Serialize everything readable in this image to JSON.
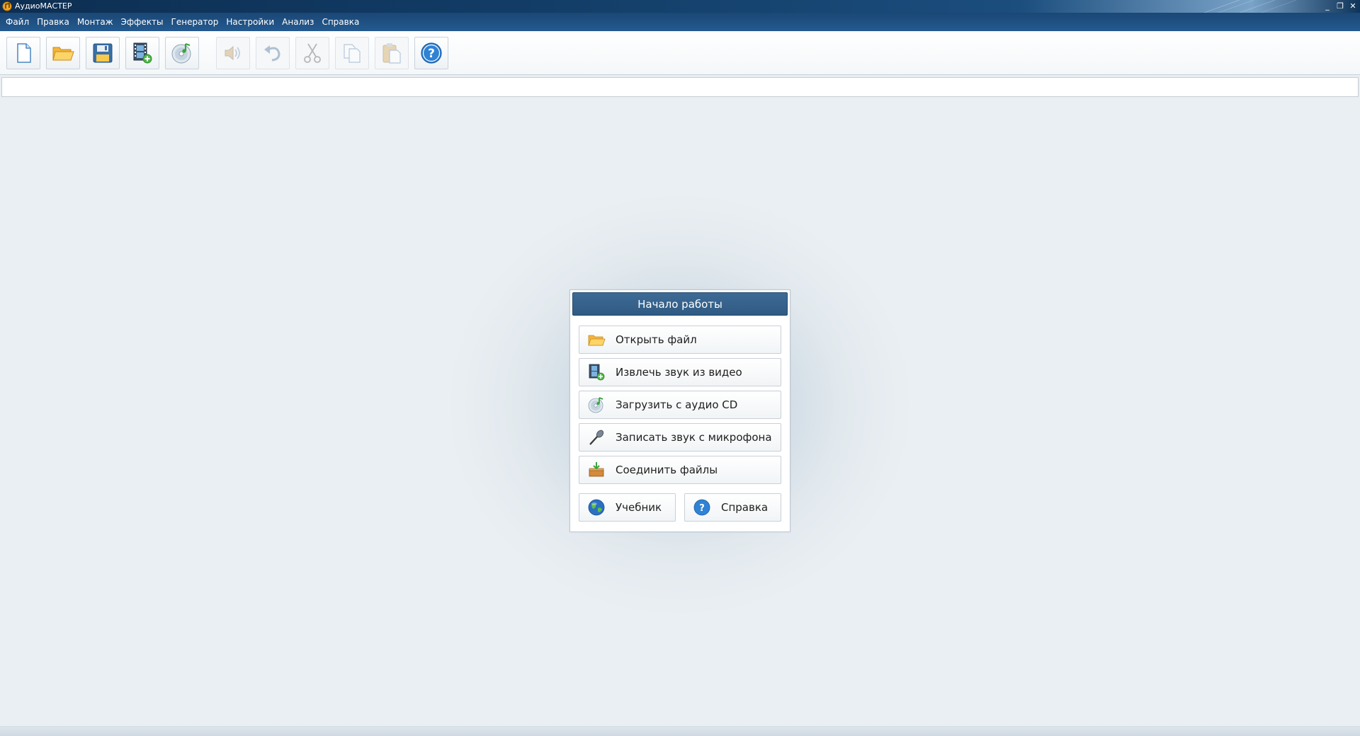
{
  "window": {
    "title": "АудиоМАСТЕР",
    "app_icon": "audiomaster-logo-icon",
    "controls": [
      "minimize-icon",
      "restore-icon",
      "close-icon"
    ],
    "controls_glyphs": {
      "minimize": "_",
      "restore": "❐",
      "close": "✕"
    }
  },
  "menu": {
    "items": [
      "Файл",
      "Правка",
      "Монтаж",
      "Эффекты",
      "Генератор",
      "Настройки",
      "Анализ",
      "Справка"
    ]
  },
  "toolbar": {
    "buttons": [
      {
        "name": "new-file-icon",
        "enabled": true
      },
      {
        "name": "open-folder-icon",
        "enabled": true
      },
      {
        "name": "save-icon",
        "enabled": true
      },
      {
        "name": "extract-from-video-icon",
        "enabled": true
      },
      {
        "name": "audio-cd-icon",
        "enabled": true
      },
      {
        "name": "play-sound-icon",
        "enabled": false
      },
      {
        "name": "undo-icon",
        "enabled": false
      },
      {
        "name": "cut-icon",
        "enabled": false
      },
      {
        "name": "copy-icon",
        "enabled": false
      },
      {
        "name": "paste-icon",
        "enabled": false
      },
      {
        "name": "help-icon",
        "enabled": true
      }
    ]
  },
  "start_dialog": {
    "title": "Начало работы",
    "buttons": {
      "open_file": {
        "label": "Открыть файл",
        "icon": "open-folder-icon"
      },
      "extract_video": {
        "label": "Извлечь звук из видео",
        "icon": "extract-from-video-icon"
      },
      "load_cd": {
        "label": "Загрузить с аудио CD",
        "icon": "audio-cd-icon"
      },
      "record_mic": {
        "label": "Записать звук с микрофона",
        "icon": "microphone-icon"
      },
      "join_files": {
        "label": "Соединить файлы",
        "icon": "join-files-icon"
      },
      "tutorial": {
        "label": "Учебник",
        "icon": "globe-icon"
      },
      "help": {
        "label": "Справка",
        "icon": "help-icon"
      }
    }
  },
  "colors": {
    "titlebar": "#123d67",
    "menubar": "#1f5284",
    "dialog_header": "#34618b",
    "workspace": "#e9eef2"
  }
}
